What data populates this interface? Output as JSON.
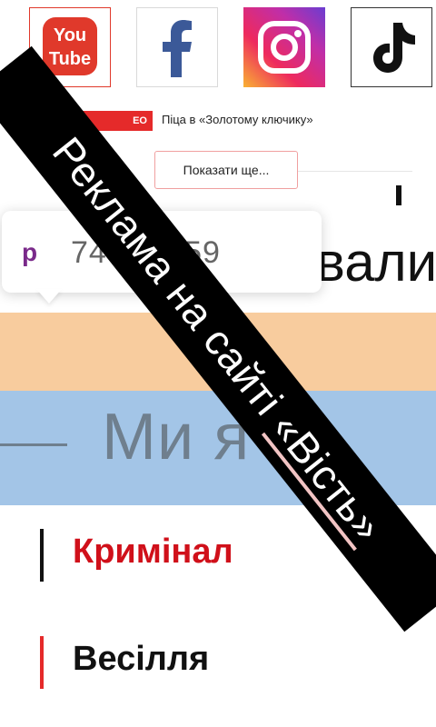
{
  "social": {
    "youtube": {
      "icon": "youtube-icon",
      "text_top": "You",
      "text_bottom": "Tube",
      "color": "#e0392b"
    },
    "facebook": {
      "icon": "facebook-icon",
      "color": "#3b5998"
    },
    "instagram": {
      "icon": "instagram-icon"
    },
    "tiktok": {
      "icon": "tiktok-icon"
    }
  },
  "video_row": {
    "badge": "ЕО",
    "title": "Піца в «Золотому ключику»"
  },
  "show_more": "Показати ще...",
  "tooltip": {
    "letter": "р",
    "value": "746⋯5.59"
  },
  "heading_fragment": "вали",
  "band": {
    "text": "Ми   я     з"
  },
  "categories": [
    {
      "label": "Кримінал",
      "active": true
    },
    {
      "label": "Весілля",
      "active": false
    }
  ],
  "ribbon": {
    "prefix": "Реклама на сайті ",
    "link": "«Вість»"
  },
  "colors": {
    "accent_red": "#d0101a",
    "orange_band": "#f8cc9e",
    "blue_band": "#a3c5e7",
    "ribbon": "#000000"
  }
}
